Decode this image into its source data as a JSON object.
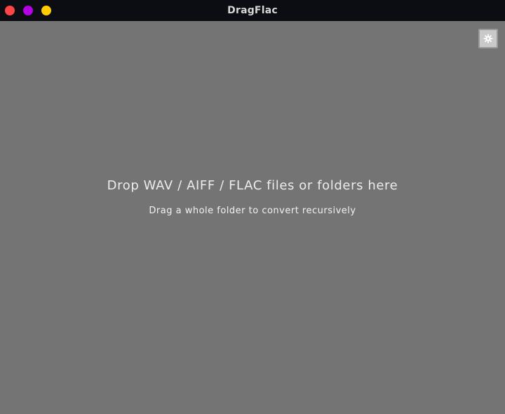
{
  "window": {
    "title": "DragFlac",
    "controls": {
      "close_color": "#ff4545",
      "maximize_color": "#b300e6",
      "minimize_color": "#ffcc00"
    }
  },
  "toolbar": {
    "settings_icon": "gear-icon"
  },
  "dropzone": {
    "primary_text": "Drop WAV / AIFF / FLAC files or folders here",
    "secondary_text": "Drag a whole folder to convert recursively"
  },
  "colors": {
    "background": "#747474",
    "titlebar": "#0c0d12"
  }
}
